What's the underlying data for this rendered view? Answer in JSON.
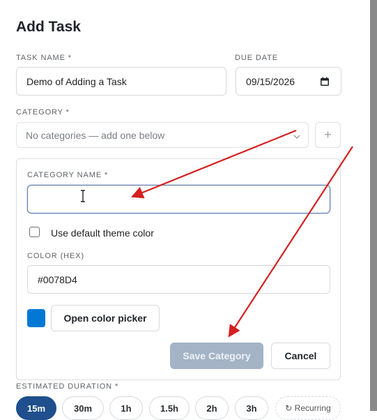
{
  "form": {
    "title": "Add Task",
    "task_name": {
      "label": "TASK NAME *",
      "value": "Demo of Adding a Task"
    },
    "due_date": {
      "label": "DUE DATE",
      "value": "09/15/2026"
    },
    "category": {
      "label": "CATEGORY *",
      "placeholder": "No categories — add one below",
      "add_button": "+"
    },
    "new_category": {
      "name_label": "CATEGORY NAME *",
      "name_value": "",
      "use_default_label": "Use default theme color",
      "use_default_checked": false,
      "color_label": "COLOR (HEX)",
      "color_value": "#0078D4",
      "picker_button": "Open color picker",
      "save_button": "Save Category",
      "cancel_button": "Cancel"
    },
    "duration": {
      "label": "ESTIMATED DURATION *",
      "options": [
        "15m",
        "30m",
        "1h",
        "1.5h",
        "2h",
        "3h"
      ],
      "selected": "15m",
      "recurring_label": "↻ Recurring"
    }
  },
  "colors": {
    "swatch": "#0078D4",
    "annotation_arrow": "#d42020",
    "chip_active": "#1f4f8c"
  },
  "icons": [
    "calendar-icon",
    "chevron-down-icon",
    "plus-icon",
    "text-cursor-icon",
    "recurring-icon"
  ]
}
